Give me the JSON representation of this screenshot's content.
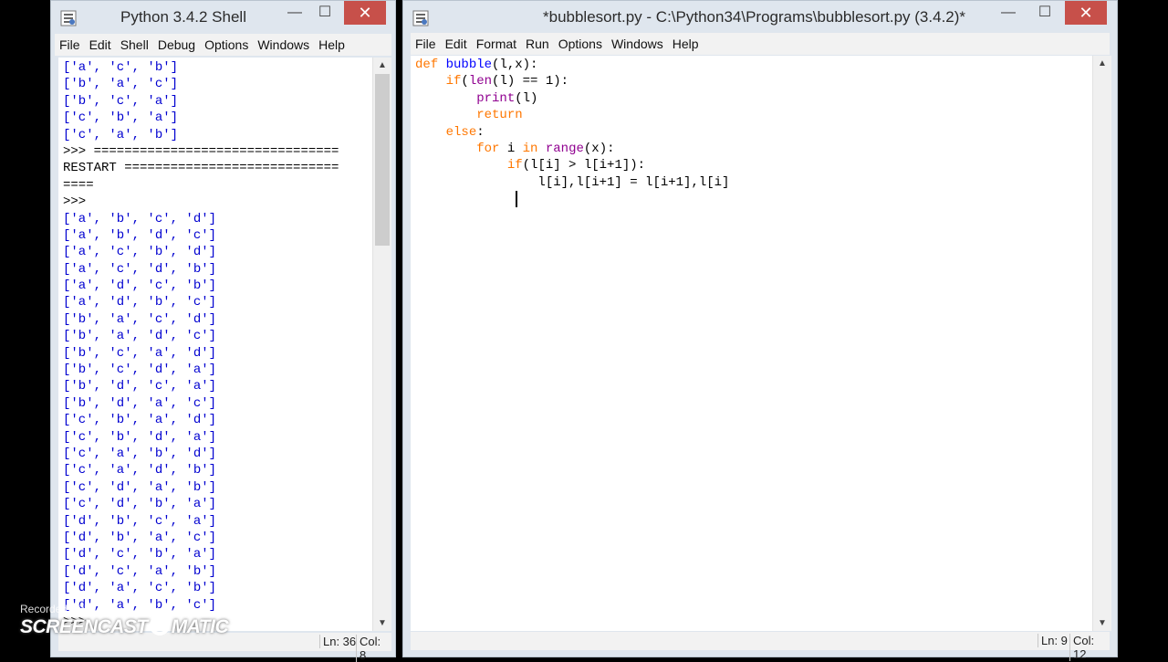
{
  "shell": {
    "title": "Python 3.4.2 Shell",
    "menu": [
      "File",
      "Edit",
      "Shell",
      "Debug",
      "Options",
      "Windows",
      "Help"
    ],
    "lines": [
      {
        "text": "['a', 'c', 'b']",
        "kind": "out"
      },
      {
        "text": "['b', 'a', 'c']",
        "kind": "out"
      },
      {
        "text": "['b', 'c', 'a']",
        "kind": "out"
      },
      {
        "text": "['c', 'b', 'a']",
        "kind": "out"
      },
      {
        "text": "['c', 'a', 'b']",
        "kind": "out"
      },
      {
        "text": ">>> ================================",
        "kind": "plain"
      },
      {
        "text": "RESTART ============================",
        "kind": "plain"
      },
      {
        "text": "====",
        "kind": "plain"
      },
      {
        "text": ">>> ",
        "kind": "plain"
      },
      {
        "text": "['a', 'b', 'c', 'd']",
        "kind": "out"
      },
      {
        "text": "['a', 'b', 'd', 'c']",
        "kind": "out"
      },
      {
        "text": "['a', 'c', 'b', 'd']",
        "kind": "out"
      },
      {
        "text": "['a', 'c', 'd', 'b']",
        "kind": "out"
      },
      {
        "text": "['a', 'd', 'c', 'b']",
        "kind": "out"
      },
      {
        "text": "['a', 'd', 'b', 'c']",
        "kind": "out"
      },
      {
        "text": "['b', 'a', 'c', 'd']",
        "kind": "out"
      },
      {
        "text": "['b', 'a', 'd', 'c']",
        "kind": "out"
      },
      {
        "text": "['b', 'c', 'a', 'd']",
        "kind": "out"
      },
      {
        "text": "['b', 'c', 'd', 'a']",
        "kind": "out"
      },
      {
        "text": "['b', 'd', 'c', 'a']",
        "kind": "out"
      },
      {
        "text": "['b', 'd', 'a', 'c']",
        "kind": "out"
      },
      {
        "text": "['c', 'b', 'a', 'd']",
        "kind": "out"
      },
      {
        "text": "['c', 'b', 'd', 'a']",
        "kind": "out"
      },
      {
        "text": "['c', 'a', 'b', 'd']",
        "kind": "out"
      },
      {
        "text": "['c', 'a', 'd', 'b']",
        "kind": "out"
      },
      {
        "text": "['c', 'd', 'a', 'b']",
        "kind": "out"
      },
      {
        "text": "['c', 'd', 'b', 'a']",
        "kind": "out"
      },
      {
        "text": "['d', 'b', 'c', 'a']",
        "kind": "out"
      },
      {
        "text": "['d', 'b', 'a', 'c']",
        "kind": "out"
      },
      {
        "text": "['d', 'c', 'b', 'a']",
        "kind": "out"
      },
      {
        "text": "['d', 'c', 'a', 'b']",
        "kind": "out"
      },
      {
        "text": "['d', 'a', 'c', 'b']",
        "kind": "out"
      },
      {
        "text": "['d', 'a', 'b', 'c']",
        "kind": "out"
      },
      {
        "text": ">>> ",
        "kind": "plain"
      }
    ],
    "status": {
      "ln": "Ln: 36",
      "col": "Col: 8"
    }
  },
  "editor": {
    "title": "*bubblesort.py - C:\\Python34\\Programs\\bubblesort.py (3.4.2)*",
    "menu": [
      "File",
      "Edit",
      "Format",
      "Run",
      "Options",
      "Windows",
      "Help"
    ],
    "lines": [
      [
        {
          "t": "def",
          "c": "kw"
        },
        {
          "t": " "
        },
        {
          "t": "bubble",
          "c": "def"
        },
        {
          "t": "(l,x):"
        }
      ],
      [
        {
          "t": "    "
        },
        {
          "t": "if",
          "c": "kw"
        },
        {
          "t": "("
        },
        {
          "t": "len",
          "c": "bi"
        },
        {
          "t": "(l) == 1):"
        }
      ],
      [
        {
          "t": "        "
        },
        {
          "t": "print",
          "c": "bi"
        },
        {
          "t": "(l)"
        }
      ],
      [
        {
          "t": "        "
        },
        {
          "t": "return",
          "c": "kw"
        }
      ],
      [
        {
          "t": "    "
        },
        {
          "t": "else",
          "c": "kw"
        },
        {
          "t": ":"
        }
      ],
      [
        {
          "t": "        "
        },
        {
          "t": "for",
          "c": "kw"
        },
        {
          "t": " i "
        },
        {
          "t": "in",
          "c": "kw"
        },
        {
          "t": " "
        },
        {
          "t": "range",
          "c": "bi"
        },
        {
          "t": "(x):"
        }
      ],
      [
        {
          "t": "            "
        },
        {
          "t": "if",
          "c": "kw"
        },
        {
          "t": "(l[i] > l[i+1]):"
        }
      ],
      [
        {
          "t": "                l[i],l[i+1] = l[i+1],l[i]"
        }
      ],
      [
        {
          "t": "            "
        }
      ]
    ],
    "status": {
      "ln": "Ln: 9",
      "col": "Col: 12"
    }
  },
  "watermark": {
    "recorded": "Recorded with",
    "brand_left": "SCREENCAST",
    "brand_right": "MATIC"
  },
  "colors": {
    "keyword": "#ff7700",
    "builtin": "#900090",
    "definition": "#0000ff",
    "output": "#0000d0",
    "close_button": "#c7504a"
  }
}
